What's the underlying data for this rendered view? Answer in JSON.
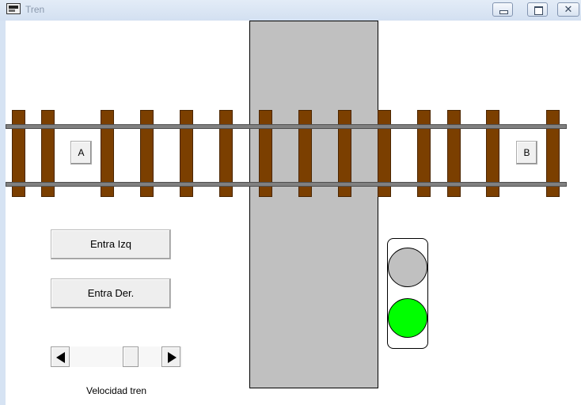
{
  "window": {
    "title": "Tren"
  },
  "tracks": {
    "left_button": "A",
    "right_button": "B"
  },
  "controls": {
    "enter_left_label": "Entra Izq",
    "enter_right_label": "Entra Der.",
    "speed_label": "Velocidad tren",
    "speed_value_fraction": 0.7
  },
  "traffic_light": {
    "top_lamp_color": "#c0c0c0",
    "bottom_lamp_color": "#00ff00",
    "active": "bottom"
  },
  "colors": {
    "tie": "#7b3f00",
    "rail": "#808080",
    "crossing": "#c0c0c0"
  },
  "icons": [
    "app-icon",
    "minimize-icon",
    "maximize-icon",
    "close-icon",
    "arrow-left-icon",
    "arrow-right-icon"
  ]
}
